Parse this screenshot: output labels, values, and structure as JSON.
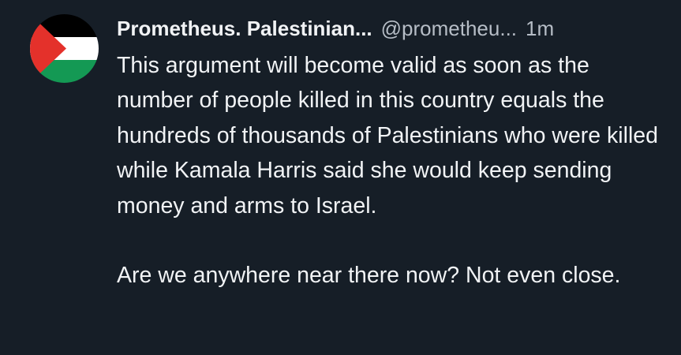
{
  "post": {
    "author": {
      "display_name": "Prometheus. Palestinian...",
      "handle": "@prometheu...",
      "avatar_icon": "palestine-flag-icon"
    },
    "timestamp": "1m",
    "paragraphs": [
      "This argument will become valid as soon as the number of people killed in this country equals the hundreds of thousands of Palestinians who were killed while Kamala Harris said she would keep sending money and arms to Israel.",
      "Are we anywhere near there now? Not even close."
    ]
  },
  "colors": {
    "background": "#161e27",
    "text_primary": "#f1f3f5",
    "text_secondary": "#b6bdc6",
    "flag_black": "#000000",
    "flag_white": "#ffffff",
    "flag_green": "#149954",
    "flag_red": "#e4312b"
  }
}
